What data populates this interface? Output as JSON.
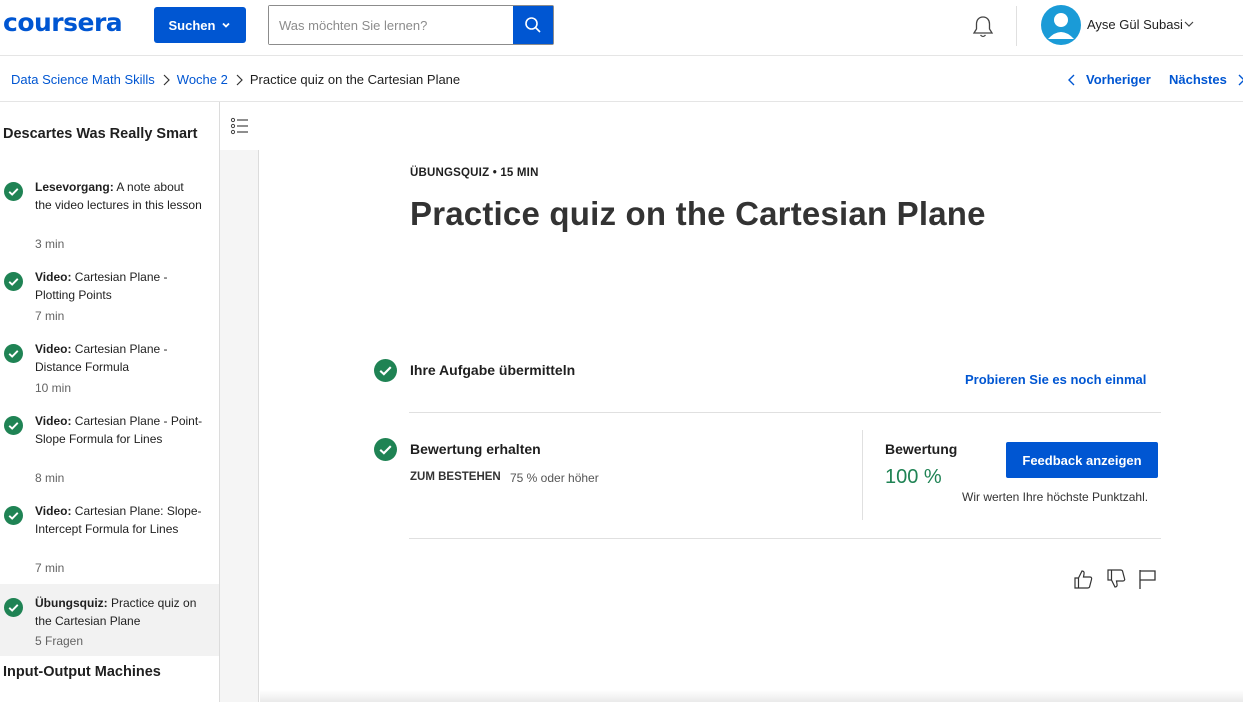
{
  "brand": {
    "logo_text": "coursera",
    "color": "#0056d2"
  },
  "header": {
    "suchen_label": "Suchen",
    "search_placeholder": "Was möchten Sie lernen?",
    "user_name": "Ayse Gül Subasi"
  },
  "breadcrumb": {
    "items": [
      "Data Science Math Skills",
      "Woche 2"
    ],
    "current": "Practice quiz on the Cartesian Plane"
  },
  "nav": {
    "prev_label": "Vorheriger",
    "next_label": "Nächstes"
  },
  "sidebar": {
    "module_title": "Descartes Was Really Smart",
    "items": [
      {
        "type": "Lesevorgang:",
        "title": " A note about the video lectures in this lesson",
        "duration": "3 min",
        "completed": true
      },
      {
        "type": "Video:",
        "title": " Cartesian Plane - Plotting Points",
        "duration": "7 min",
        "completed": true
      },
      {
        "type": "Video:",
        "title": " Cartesian Plane - Distance Formula",
        "duration": "10 min",
        "completed": true
      },
      {
        "type": "Video:",
        "title": " Cartesian Plane - Point-Slope Formula for Lines",
        "duration": "8 min",
        "completed": true
      },
      {
        "type": "Video:",
        "title": " Cartesian Plane: Slope-Intercept Formula for Lines",
        "duration": "7 min",
        "completed": true
      },
      {
        "type": "Übungsquiz:",
        "title": " Practice quiz on the Cartesian Plane",
        "duration": "5 Fragen",
        "completed": true,
        "active": true
      }
    ],
    "next_module_title": "Input-Output Machines"
  },
  "main": {
    "kicker": "ÜBUNGSQUIZ • 15 MIN",
    "title": "Practice quiz on the Cartesian Plane",
    "step1": {
      "title": "Ihre Aufgabe übermitteln",
      "action": "Probieren Sie es noch einmal"
    },
    "step2": {
      "title": "Bewertung erhalten",
      "pass_label": "ZUM BESTEHEN",
      "pass_value": "75 % oder höher",
      "grade_label": "Bewertung",
      "grade_value": "100 %",
      "feedback_button": "Feedback anzeigen",
      "grade_note": "Wir werten Ihre höchste Punktzahl."
    }
  },
  "colors": {
    "accent": "#0056d2",
    "success": "#1f8354",
    "avatar": "#1a9bd7"
  },
  "icons": [
    "search-icon",
    "bell-icon",
    "avatar-icon",
    "chevron-down-icon",
    "chevron-right-icon",
    "chevron-left-icon",
    "list-icon",
    "check-circle-icon",
    "thumbs-up-icon",
    "thumbs-down-icon",
    "flag-icon"
  ]
}
